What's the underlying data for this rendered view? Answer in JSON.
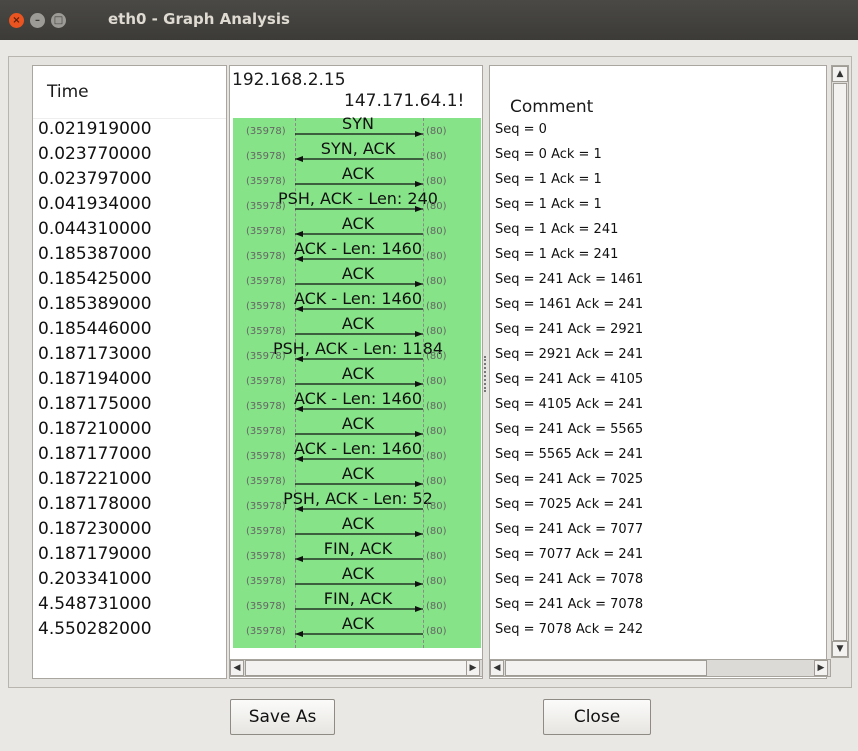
{
  "window": {
    "title": "eth0 - Graph Analysis",
    "close_glyph": "×",
    "minimize_glyph": "–",
    "maximize_glyph": "□"
  },
  "time_column": {
    "header": "Time",
    "rows": [
      "0.021919000",
      "0.023770000",
      "0.023797000",
      "0.041934000",
      "0.044310000",
      "0.185387000",
      "0.185425000",
      "0.185389000",
      "0.185446000",
      "0.187173000",
      "0.187194000",
      "0.187175000",
      "0.187210000",
      "0.187177000",
      "0.187221000",
      "0.187178000",
      "0.187230000",
      "0.187179000",
      "0.203341000",
      "4.548731000",
      "4.550282000"
    ]
  },
  "graph": {
    "host_left": "192.168.2.15",
    "host_right": "147.171.64.1!",
    "port_left": "(35978)",
    "port_right": "(80)",
    "packets": [
      {
        "label": "SYN",
        "dir": "right"
      },
      {
        "label": "SYN, ACK",
        "dir": "left"
      },
      {
        "label": "ACK",
        "dir": "right"
      },
      {
        "label": "PSH, ACK - Len: 240",
        "dir": "right"
      },
      {
        "label": "ACK",
        "dir": "left"
      },
      {
        "label": "ACK - Len: 1460",
        "dir": "left"
      },
      {
        "label": "ACK",
        "dir": "right"
      },
      {
        "label": "ACK - Len: 1460",
        "dir": "left"
      },
      {
        "label": "ACK",
        "dir": "right"
      },
      {
        "label": "PSH, ACK - Len: 1184",
        "dir": "left"
      },
      {
        "label": "ACK",
        "dir": "right"
      },
      {
        "label": "ACK - Len: 1460",
        "dir": "left"
      },
      {
        "label": "ACK",
        "dir": "right"
      },
      {
        "label": "ACK - Len: 1460",
        "dir": "left"
      },
      {
        "label": "ACK",
        "dir": "right"
      },
      {
        "label": "PSH, ACK - Len: 52",
        "dir": "left"
      },
      {
        "label": "ACK",
        "dir": "right"
      },
      {
        "label": "FIN, ACK",
        "dir": "left"
      },
      {
        "label": "ACK",
        "dir": "right"
      },
      {
        "label": "FIN, ACK",
        "dir": "right"
      },
      {
        "label": "ACK",
        "dir": "left"
      }
    ]
  },
  "comment_column": {
    "header": "Comment",
    "rows": [
      "Seq = 0",
      "Seq = 0 Ack = 1",
      "Seq = 1 Ack = 1",
      "Seq = 1 Ack = 1",
      "Seq = 1 Ack = 241",
      "Seq = 1 Ack = 241",
      "Seq = 241 Ack = 1461",
      "Seq = 1461 Ack = 241",
      "Seq = 241 Ack = 2921",
      "Seq = 2921 Ack = 241",
      "Seq = 241 Ack = 4105",
      "Seq = 4105 Ack = 241",
      "Seq = 241 Ack = 5565",
      "Seq = 5565 Ack = 241",
      "Seq = 241 Ack = 7025",
      "Seq = 7025 Ack = 241",
      "Seq = 241 Ack = 7077",
      "Seq = 7077 Ack = 241",
      "Seq = 241 Ack = 7078",
      "Seq = 241 Ack = 7078",
      "Seq = 7078 Ack = 242"
    ]
  },
  "buttons": {
    "save_as": "Save As",
    "close": "Close"
  },
  "scroll": {
    "left_arrow": "◀",
    "right_arrow": "▶",
    "up_arrow": "▲",
    "down_arrow": "▼"
  },
  "colors": {
    "graph_bg": "#86e387",
    "titlebar": "#3c3b37",
    "close_btn": "#e95420"
  }
}
